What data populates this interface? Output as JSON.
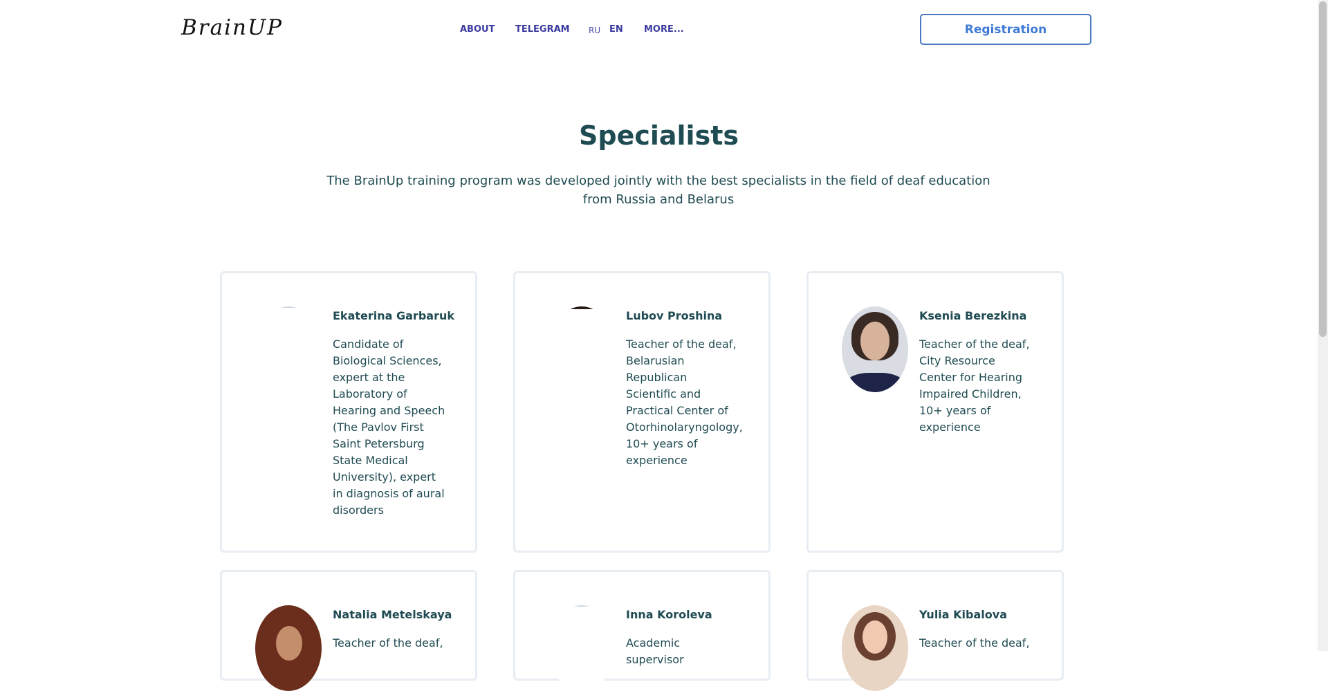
{
  "brand": {
    "logo_text": "BrainUP"
  },
  "nav": {
    "about": "ABOUT",
    "telegram": "TELEGRAM",
    "lang_ru": "RU",
    "lang_en": "EN",
    "more": "MORE..."
  },
  "header": {
    "registration_label": "Registration"
  },
  "section": {
    "title": "Specialists",
    "subtitle": "The BrainUp training program was developed jointly with the best specialists in the field of deaf education from Russia and Belarus"
  },
  "specialists": [
    {
      "name": "Ekaterina Garbaruk",
      "description": "Candidate of Biological Sciences, expert at the Laboratory of Hearing and Speech (The Pavlov First Saint Petersburg State Medical University), expert in diagnosis of aural disorders"
    },
    {
      "name": "Lubov Proshina",
      "description": "Teacher of the deaf, Belarusian Republican Scientific and Practical Center of Otorhinolaryngology, 10+ years of experience"
    },
    {
      "name": "Ksenia Berezkina",
      "description": "Teacher of the deaf, City Resource Center for Hearing Impaired Children, 10+ years of experience"
    },
    {
      "name": "Natalia Metelskaya",
      "description": "Teacher of the deaf,"
    },
    {
      "name": "Inna Koroleva",
      "description": "Academic supervisor"
    },
    {
      "name": "Yulia Kibalova",
      "description": "Teacher of the deaf,"
    }
  ],
  "colors": {
    "heading": "#1f4b52",
    "nav": "#3b3ba0",
    "button_border": "#4a78c0",
    "button_text": "#3e7ad6",
    "card_border": "#e7edf2"
  }
}
